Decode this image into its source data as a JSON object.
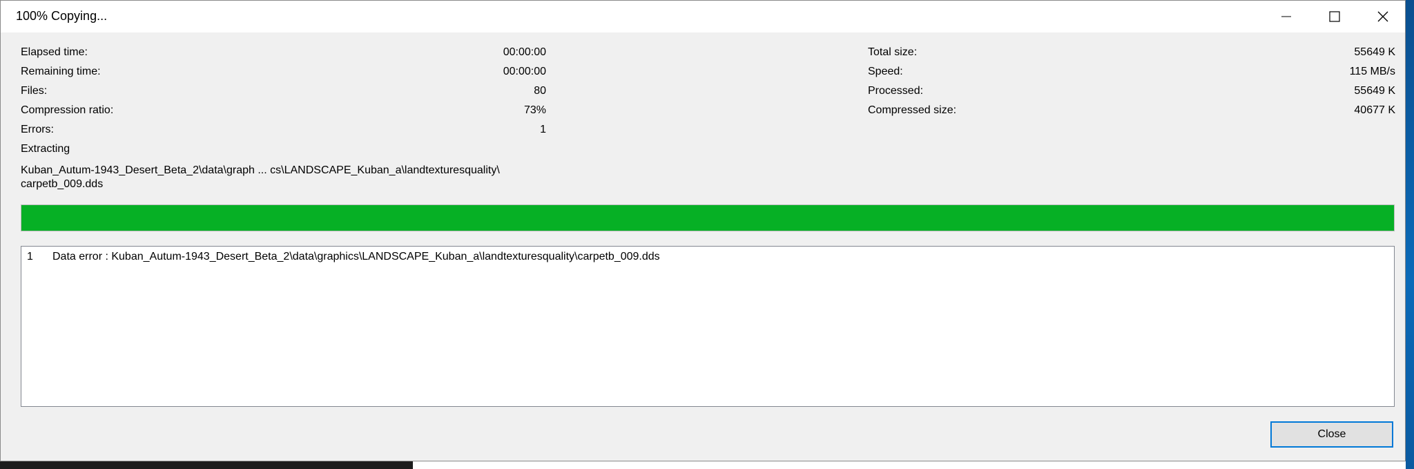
{
  "window": {
    "title": "100% Copying..."
  },
  "stats_left": [
    {
      "label": "Elapsed time:",
      "value": "00:00:00"
    },
    {
      "label": "Remaining time:",
      "value": "00:00:00"
    },
    {
      "label": "Files:",
      "value": "80"
    },
    {
      "label": "Compression ratio:",
      "value": "73%"
    },
    {
      "label": "Errors:",
      "value": "1"
    }
  ],
  "stats_right": [
    {
      "label": "Total size:",
      "value": "55649 K"
    },
    {
      "label": "Speed:",
      "value": "115 MB/s"
    },
    {
      "label": "Processed:",
      "value": "55649 K"
    },
    {
      "label": "Compressed size:",
      "value": "40677 K"
    }
  ],
  "operation": "Extracting",
  "current_path": {
    "line1": "Kuban_Autum-1943_Desert_Beta_2\\data\\graph ... cs\\LANDSCAPE_Kuban_a\\landtexturesquality\\",
    "line2": "carpetb_009.dds"
  },
  "progress": {
    "fraction": 1.0,
    "color": "#06b025"
  },
  "log": [
    {
      "index": "1",
      "message": "Data error : Kuban_Autum-1943_Desert_Beta_2\\data\\graphics\\LANDSCAPE_Kuban_a\\landtexturesquality\\carpetb_009.dds"
    }
  ],
  "buttons": {
    "close": "Close"
  }
}
